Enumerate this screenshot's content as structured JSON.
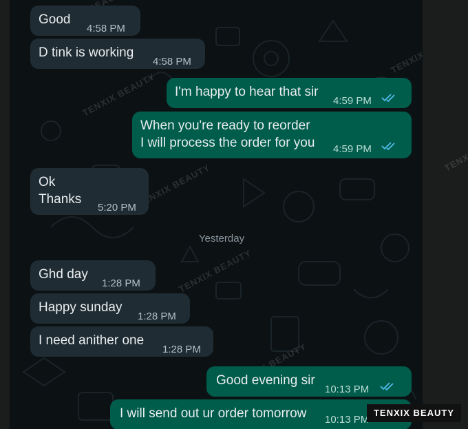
{
  "date_separator": "Yesterday",
  "watermark": "TENXIX BEAUTY",
  "brand_label": "TENXIX BEAUTY",
  "colors": {
    "background": "#0c1114",
    "incoming_bubble": "#1f2c34",
    "outgoing_bubble": "#005c4b",
    "read_ticks": "#53bdeb"
  },
  "messages": [
    {
      "dir": "in",
      "text": "Good",
      "time": "4:58 PM"
    },
    {
      "dir": "in",
      "text": "D tink is working",
      "time": "4:58 PM"
    },
    {
      "dir": "out",
      "text": "I'm happy to hear that sir",
      "time": "4:59 PM",
      "status": "read"
    },
    {
      "dir": "out",
      "text": "When you're ready to reorder\nI will process the order for you",
      "time": "4:59 PM",
      "status": "read"
    },
    {
      "dir": "in",
      "text": "Ok\nThanks",
      "time": "5:20 PM"
    },
    {
      "dir": "in",
      "text": "Ghd day",
      "time": "1:28 PM"
    },
    {
      "dir": "in",
      "text": "Happy sunday",
      "time": "1:28 PM"
    },
    {
      "dir": "in",
      "text": "I need anither one",
      "time": "1:28 PM"
    },
    {
      "dir": "out",
      "text": "Good evening sir",
      "time": "10:13 PM",
      "status": "read"
    },
    {
      "dir": "out",
      "text": "I will send out ur order tomorrow",
      "time": "10:13 PM",
      "status": "read"
    }
  ]
}
